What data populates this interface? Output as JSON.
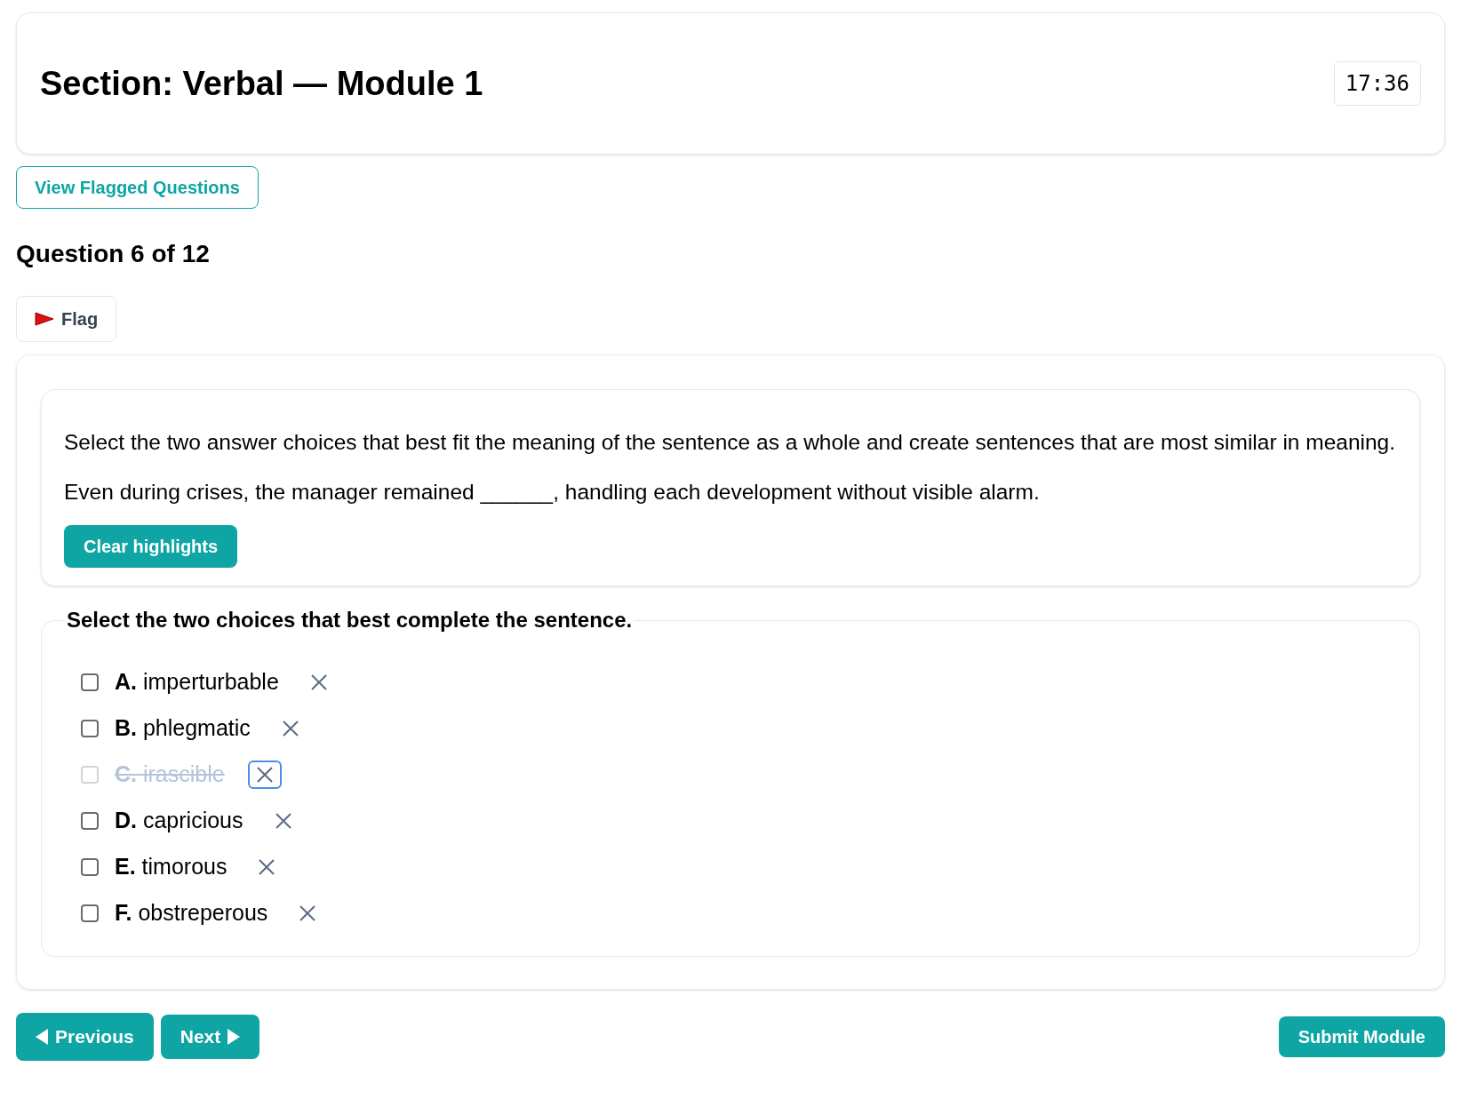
{
  "header": {
    "title": "Section: Verbal — Module 1",
    "timer": "17:36"
  },
  "view_flagged_button": "View Flagged Questions",
  "question_heading": "Question 6 of 12",
  "flag_button": {
    "label": "Flag",
    "flagged": false
  },
  "passage": {
    "instruction": "Select the two answer choices that best fit the meaning of the sentence as a whole and create sentences that are most similar in meaning.",
    "sentence": "Even during crises, the manager remained ______, handling each development without visible alarm.",
    "clear_button": "Clear highlights"
  },
  "choices_legend": "Select the two choices that best complete the sentence.",
  "choices": [
    {
      "letter": "A.",
      "text": "imperturbable",
      "checked": false,
      "eliminated": false
    },
    {
      "letter": "B.",
      "text": "phlegmatic",
      "checked": false,
      "eliminated": false
    },
    {
      "letter": "C.",
      "text": "irascible",
      "checked": false,
      "eliminated": true
    },
    {
      "letter": "D.",
      "text": "capricious",
      "checked": false,
      "eliminated": false
    },
    {
      "letter": "E.",
      "text": "timorous",
      "checked": false,
      "eliminated": false
    },
    {
      "letter": "F.",
      "text": "obstreperous",
      "checked": false,
      "eliminated": false
    }
  ],
  "footer": {
    "previous": "Previous",
    "next": "Next",
    "submit": "Submit Module"
  }
}
